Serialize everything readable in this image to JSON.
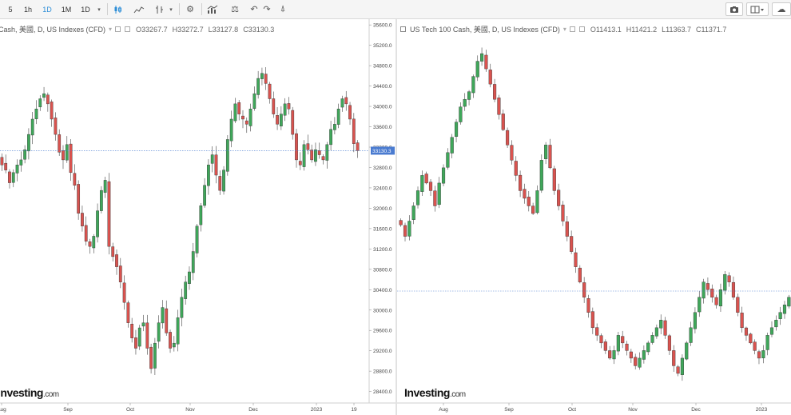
{
  "toolbar": {
    "intervals": [
      "5",
      "1h",
      "1D",
      "1M",
      "1D"
    ],
    "active_interval": "1D"
  },
  "left_pane": {
    "legend_title": "Cash, 美國, D, US Indexes (CFD)",
    "open": "O33267.7",
    "high": "H33272.7",
    "low": "L33127.8",
    "close": "C33130.3",
    "last_price_label": "33130.3",
    "y_ticks": [
      "35600.0",
      "35200.0",
      "34800.0",
      "34400.0",
      "34000.0",
      "33600.0",
      "33200.0",
      "32800.0",
      "32400.0",
      "32000.0",
      "31600.0",
      "31200.0",
      "30800.0",
      "30400.0",
      "30000.0",
      "29600.0",
      "29200.0",
      "28800.0",
      "28400.0"
    ],
    "x_ticks": [
      "Aug",
      "Sep",
      "Oct",
      "Nov",
      "Dec",
      "2023",
      "19"
    ],
    "watermark": "Investing",
    "watermark_suffix": ".com"
  },
  "right_pane": {
    "legend_title": "US Tech 100 Cash, 美國, D, US Indexes (CFD)",
    "open": "O11413.1",
    "high": "H11421.2",
    "low": "L11363.7",
    "close": "C11371.7",
    "x_ticks": [
      "Aug",
      "Sep",
      "Oct",
      "Nov",
      "Dec",
      "2023"
    ],
    "watermark": "Investing",
    "watermark_suffix": ".com"
  },
  "colors": {
    "up": "#3fa75a",
    "down": "#d9534f",
    "price_line": "#4a7bd0",
    "price_label_bg": "#4a7bd0"
  },
  "chart_data": [
    {
      "type": "candlestick",
      "title": "",
      "ylim": [
        28300,
        35650
      ],
      "y_ticks": [
        35600,
        35200,
        34800,
        34400,
        34000,
        33600,
        33200,
        32800,
        32400,
        32000,
        31600,
        31200,
        30800,
        30400,
        30000,
        29600,
        29200,
        28800,
        28400
      ],
      "last_price": 33130.3,
      "closes": [
        32850,
        32750,
        32500,
        32700,
        32850,
        32950,
        33150,
        33450,
        33750,
        33950,
        34150,
        34250,
        34050,
        33750,
        33450,
        33100,
        32950,
        33250,
        32700,
        32450,
        31900,
        31650,
        31350,
        31250,
        31450,
        31950,
        32350,
        32550,
        31250,
        31050,
        30850,
        30550,
        30150,
        29750,
        29450,
        29250,
        29650,
        29750,
        29250,
        28850,
        29350,
        29750,
        30050,
        29550,
        29250,
        29350,
        29850,
        30250,
        30550,
        30750,
        31150,
        31650,
        32050,
        32450,
        32850,
        33050,
        32650,
        32350,
        32750,
        33350,
        33750,
        34050,
        33850,
        33750,
        33650,
        33950,
        34250,
        34550,
        34650,
        34450,
        34150,
        33850,
        33650,
        33850,
        34050,
        33950,
        33450,
        32950,
        32850,
        33250,
        33150,
        32950,
        33150,
        33050,
        32950,
        33250,
        33550,
        33650,
        33950,
        34150,
        34050,
        33750,
        33267,
        33130
      ]
    },
    {
      "type": "candlestick",
      "title": "",
      "ylim": [
        12700,
        15900
      ],
      "last_price": 11371.7,
      "closes": [
        12800,
        12650,
        12850,
        13050,
        13250,
        13450,
        13350,
        13250,
        13050,
        13350,
        13550,
        13750,
        13950,
        14150,
        14350,
        14450,
        14550,
        14750,
        14950,
        15050,
        14850,
        14650,
        14450,
        14250,
        14050,
        13850,
        13650,
        13450,
        13250,
        13150,
        13050,
        12950,
        13250,
        13650,
        13850,
        13550,
        13250,
        13050,
        12850,
        12650,
        12450,
        12250,
        12050,
        11850,
        11650,
        11450,
        11350,
        11250,
        11150,
        11050,
        11150,
        11350,
        11250,
        11150,
        11050,
        10950,
        11050,
        11150,
        11250,
        11350,
        11450,
        11550,
        11350,
        11150,
        10950,
        10850,
        11050,
        11250,
        11450,
        11650,
        11850,
        12050,
        11950,
        11850,
        11750,
        11950,
        12150,
        12050,
        11850,
        11650,
        11450,
        11350,
        11250,
        11150,
        11050,
        11150,
        11350,
        11450,
        11550,
        11650,
        11750,
        11850
      ]
    }
  ]
}
